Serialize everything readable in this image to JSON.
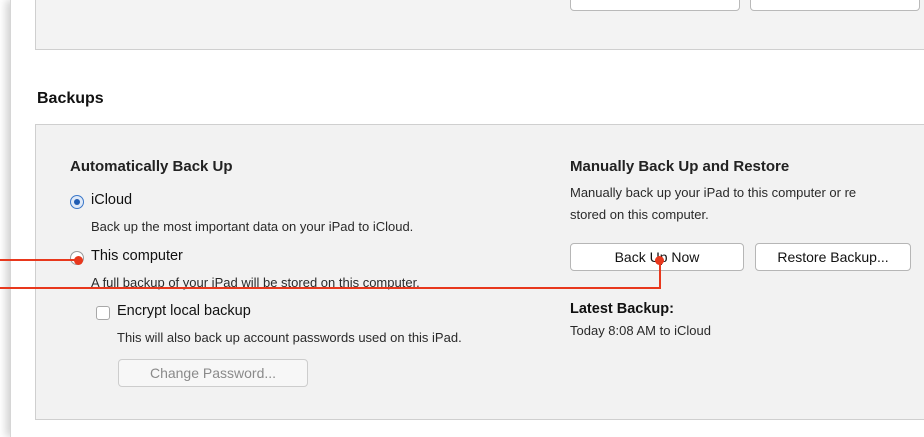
{
  "backups": {
    "section_title": "Backups",
    "auto": {
      "heading": "Automatically Back Up",
      "icloud_label": "iCloud",
      "icloud_desc": "Back up the most important data on your iPad to iCloud.",
      "computer_label": "This computer",
      "computer_desc": "A full backup of your iPad will be stored on this computer.",
      "encrypt_label": "Encrypt local backup",
      "encrypt_desc": "This will also back up account passwords used on this iPad.",
      "change_password_label": "Change Password...",
      "selected_option": "iCloud",
      "encrypt_checked": false
    },
    "manual": {
      "heading": "Manually Back Up and Restore",
      "desc_line1": "Manually back up your iPad to this computer or re",
      "desc_line2": "stored on this computer.",
      "back_up_now_label": "Back Up Now",
      "restore_label": "Restore Backup...",
      "latest_heading": "Latest Backup:",
      "latest_value": "Today 8:08 AM to iCloud"
    }
  },
  "colors": {
    "callout": "#e8381d",
    "panel_bg": "#f2f2f2",
    "radio_selected": "#1f5cb3"
  }
}
